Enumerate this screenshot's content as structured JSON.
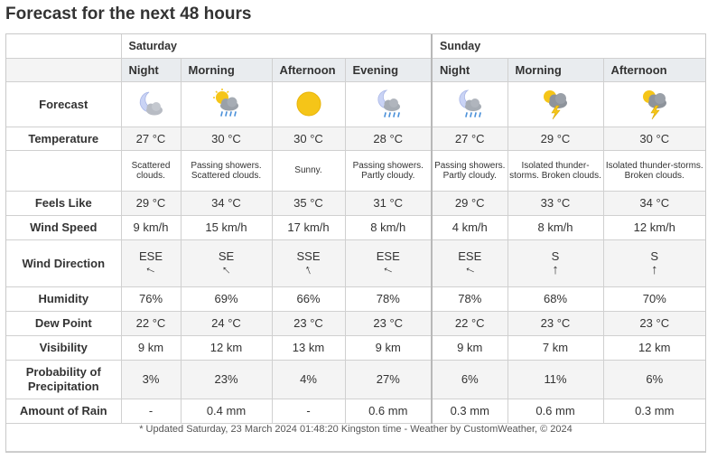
{
  "page_title": "Forecast for the next 48 hours",
  "days": [
    {
      "label": "Saturday"
    },
    {
      "label": "Sunday"
    }
  ],
  "periods": [
    {
      "name": "Night",
      "icon": "night-partly-cloudy-icon",
      "temp": "27 °C",
      "cond": "Scattered clouds.",
      "feels": "29 °C",
      "wind_speed": "9 km/h",
      "wind_dir": "ESE",
      "wind_arrow": "↑",
      "arrow_rot": -65,
      "humidity": "76%",
      "dew": "22 °C",
      "vis": "9 km",
      "pop": "3%",
      "rain": "-"
    },
    {
      "name": "Morning",
      "icon": "sun-showers-icon",
      "temp": "30 °C",
      "cond": "Passing showers. Scattered clouds.",
      "feels": "34 °C",
      "wind_speed": "15 km/h",
      "wind_dir": "SE",
      "wind_arrow": "↑",
      "arrow_rot": -45,
      "humidity": "69%",
      "dew": "24 °C",
      "vis": "12 km",
      "pop": "23%",
      "rain": "0.4 mm"
    },
    {
      "name": "Afternoon",
      "icon": "sun-icon",
      "temp": "30 °C",
      "cond": "Sunny.",
      "feels": "35 °C",
      "wind_speed": "17 km/h",
      "wind_dir": "SSE",
      "wind_arrow": "↑",
      "arrow_rot": -22,
      "humidity": "66%",
      "dew": "23 °C",
      "vis": "13 km",
      "pop": "4%",
      "rain": "-"
    },
    {
      "name": "Evening",
      "icon": "night-showers-icon",
      "temp": "28 °C",
      "cond": "Passing showers. Partly cloudy.",
      "feels": "31 °C",
      "wind_speed": "8 km/h",
      "wind_dir": "ESE",
      "wind_arrow": "↑",
      "arrow_rot": -65,
      "humidity": "78%",
      "dew": "23 °C",
      "vis": "9 km",
      "pop": "27%",
      "rain": "0.6 mm"
    },
    {
      "name": "Night",
      "icon": "night-showers-icon",
      "temp": "27 °C",
      "cond": "Passing showers. Partly cloudy.",
      "feels": "29 °C",
      "wind_speed": "4 km/h",
      "wind_dir": "ESE",
      "wind_arrow": "↑",
      "arrow_rot": -65,
      "humidity": "78%",
      "dew": "22 °C",
      "vis": "9 km",
      "pop": "6%",
      "rain": "0.3 mm"
    },
    {
      "name": "Morning",
      "icon": "thunderstorm-icon",
      "temp": "29 °C",
      "cond": "Isolated thunder-storms. Broken clouds.",
      "feels": "33 °C",
      "wind_speed": "8 km/h",
      "wind_dir": "S",
      "wind_arrow": "↑",
      "arrow_rot": 0,
      "humidity": "68%",
      "dew": "23 °C",
      "vis": "7 km",
      "pop": "11%",
      "rain": "0.6 mm"
    },
    {
      "name": "Afternoon",
      "icon": "thunderstorm-icon",
      "temp": "30 °C",
      "cond": "Isolated thunder-storms. Broken clouds.",
      "feels": "34 °C",
      "wind_speed": "12 km/h",
      "wind_dir": "S",
      "wind_arrow": "↑",
      "arrow_rot": 0,
      "humidity": "70%",
      "dew": "23 °C",
      "vis": "12 km",
      "pop": "6%",
      "rain": "0.3 mm"
    }
  ],
  "row_labels": {
    "forecast": "Forecast",
    "temperature": "Temperature",
    "feels": "Feels Like",
    "wind_speed": "Wind Speed",
    "wind_dir": "Wind Direction",
    "humidity": "Humidity",
    "dew": "Dew Point",
    "vis": "Visibility",
    "pop": "Probability of Precipitation",
    "rain": "Amount of Rain"
  },
  "footer": "* Updated Saturday, 23 March 2024 01:48:20 Kingston time - Weather by CustomWeather, © 2024",
  "colors": {
    "sun": "#f5c518",
    "cloud": "#b8bcc4",
    "moon": "#c9d3f5",
    "rain": "#4a90d9",
    "bolt": "#f5c518",
    "header_bg": "#e9ecef"
  }
}
